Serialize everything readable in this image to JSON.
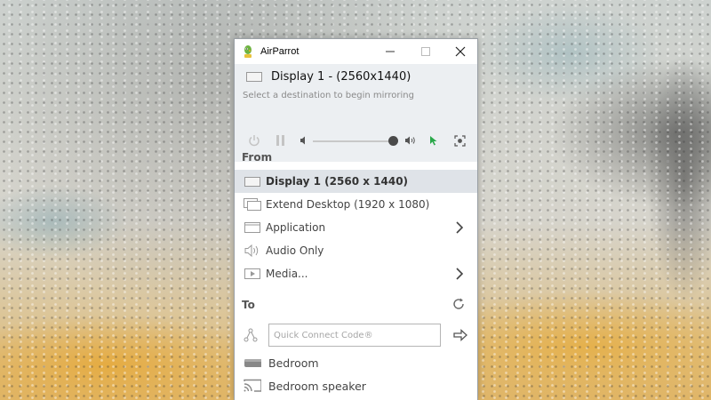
{
  "window": {
    "title": "AirParrot"
  },
  "header": {
    "display_title": "Display 1 - (2560x1440)",
    "subtitle": "Select a destination to begin mirroring",
    "volume_level": 0.92,
    "icons": [
      "power-icon",
      "pause-icon",
      "volume-low-icon",
      "volume-high-icon",
      "cursor-icon",
      "screenshot-icon"
    ],
    "accent_color": "#2aa84a"
  },
  "from": {
    "heading": "From",
    "items": [
      {
        "label": "Display 1 (2560 x 1440)",
        "icon": "monitor-icon",
        "selected": true
      },
      {
        "label": "Extend Desktop (1920 x 1080)",
        "icon": "extend-desktop-icon"
      },
      {
        "label": "Application",
        "icon": "window-icon",
        "submenu": true
      },
      {
        "label": "Audio Only",
        "icon": "speaker-icon"
      },
      {
        "label": "Media...",
        "icon": "media-play-icon",
        "submenu": true
      }
    ]
  },
  "to": {
    "heading": "To",
    "quick_connect_placeholder": "Quick Connect Code®",
    "devices": [
      {
        "label": "Bedroom",
        "icon": "apple-tv-icon"
      },
      {
        "label": "Bedroom speaker",
        "icon": "cast-icon"
      }
    ]
  }
}
